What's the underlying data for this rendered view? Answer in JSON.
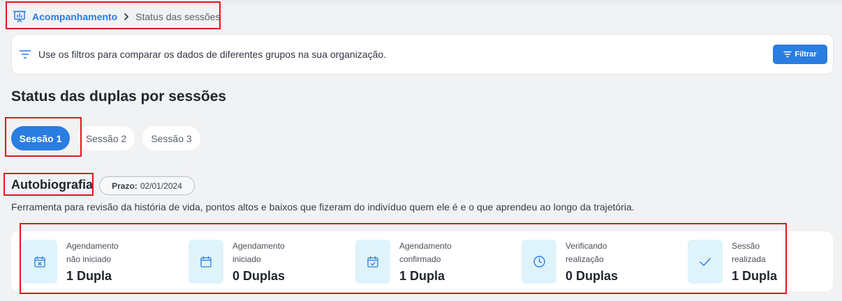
{
  "breadcrumb": {
    "parent": "Acompanhamento",
    "current": "Status das sessões"
  },
  "filter_bar": {
    "hint": "Use os filtros para comparar os dados de diferentes grupos na sua organização.",
    "button_label": "Filtrar"
  },
  "section": {
    "title": "Status das duplas por sessões"
  },
  "tabs": [
    {
      "label": "Sessão 1",
      "active": true
    },
    {
      "label": "Sessão 2",
      "active": false
    },
    {
      "label": "Sessão 3",
      "active": false
    }
  ],
  "tool": {
    "title": "Autobiografia",
    "deadline_label": "Prazo:",
    "deadline_value": "02/01/2024",
    "description": "Ferramenta para revisão da história de vida, pontos altos e baixos que fizeram do indivíduo quem ele é e o que aprendeu ao longo da trajetória."
  },
  "status_cards": [
    {
      "line1": "Agendamento",
      "line2": "não iniciado",
      "value": "1 Dupla",
      "icon": "calendar-x-icon"
    },
    {
      "line1": "Agendamento",
      "line2": "iniciado",
      "value": "0 Duplas",
      "icon": "calendar-icon"
    },
    {
      "line1": "Agendamento",
      "line2": "confirmado",
      "value": "1 Dupla",
      "icon": "calendar-check-icon"
    },
    {
      "line1": "Verificando",
      "line2": "realização",
      "value": "0 Duplas",
      "icon": "clock-icon"
    },
    {
      "line1": "Sessão",
      "line2": "realizada",
      "value": "1 Dupla",
      "icon": "check-icon"
    }
  ],
  "colors": {
    "accent": "#2a7de1",
    "icon_bg": "#dff3fb",
    "icon_stroke": "#2a7de1",
    "highlight_border": "#e0181f",
    "page_bg": "#f1f2f4"
  }
}
